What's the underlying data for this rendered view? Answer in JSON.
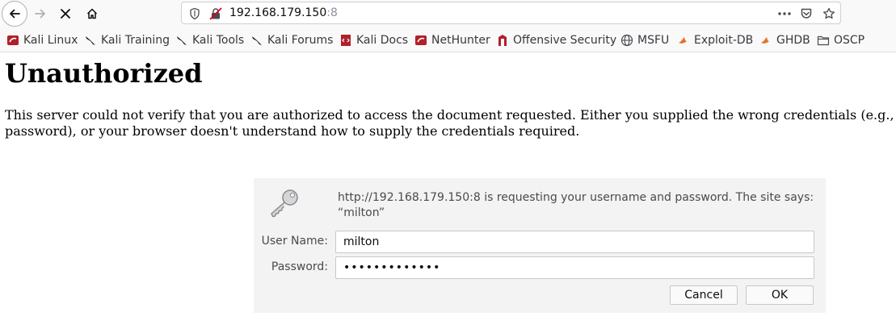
{
  "browser": {
    "url_host": "192.168.179.150",
    "url_port": ":8"
  },
  "bookmarks": [
    {
      "label": "Kali Linux",
      "icon": "kali-linux-icon"
    },
    {
      "label": "Kali Training",
      "icon": "kali-dragon-icon"
    },
    {
      "label": "Kali Tools",
      "icon": "kali-dragon-icon"
    },
    {
      "label": "Kali Forums",
      "icon": "kali-dragon-icon"
    },
    {
      "label": "Kali Docs",
      "icon": "kali-docs-icon"
    },
    {
      "label": "NetHunter",
      "icon": "nethunter-icon"
    },
    {
      "label": "Offensive Security",
      "icon": "offsec-icon"
    },
    {
      "label": "MSFU",
      "icon": "globe-icon"
    },
    {
      "label": "Exploit-DB",
      "icon": "exploitdb-icon"
    },
    {
      "label": "GHDB",
      "icon": "ghdb-icon"
    },
    {
      "label": "OSCP",
      "icon": "folder-icon"
    }
  ],
  "page": {
    "title": "Unauthorized",
    "body": "This server could not verify that you are authorized to access the document requested. Either you supplied the wrong credentials (e.g., bad password), or your browser doesn't understand how to supply the credentials required."
  },
  "auth_dialog": {
    "message": "http://192.168.179.150:8 is requesting your username and password. The site says: “milton”",
    "username_label": "User Name:",
    "username_value": "milton",
    "password_label": "Password:",
    "password_value": "•••••••••••••",
    "cancel_label": "Cancel",
    "ok_label": "OK"
  }
}
